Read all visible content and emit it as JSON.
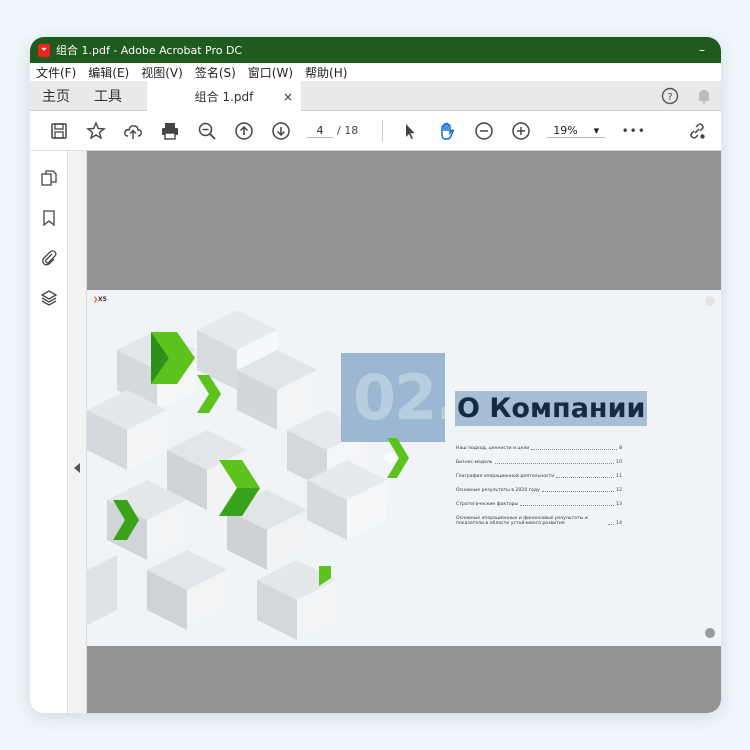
{
  "window": {
    "title": "组合 1.pdf - Adobe Acrobat Pro DC",
    "minimize_glyph": "–"
  },
  "menu": [
    "文件(F)",
    "编辑(E)",
    "视图(V)",
    "签名(S)",
    "窗口(W)",
    "帮助(H)"
  ],
  "tabs": {
    "home": "主页",
    "tools": "工具",
    "document": "组合 1.pdf",
    "close_glyph": "×"
  },
  "toolbar": {
    "page_current": "4",
    "page_total": "/ 18",
    "zoom": "19%",
    "zoom_caret": "▾",
    "more": "•••"
  },
  "document": {
    "brand": "X5",
    "chapter_number": "02.",
    "heading": "О Компании",
    "toc": [
      {
        "title": "Наш подход, ценности и цели",
        "page": "8"
      },
      {
        "title": "Бизнес-модель",
        "page": "10"
      },
      {
        "title": "География операционной деятельности",
        "page": "11"
      },
      {
        "title": "Основные результаты в 2020 году",
        "page": "12"
      },
      {
        "title": "Стратегические факторы",
        "page": "13"
      },
      {
        "title": "Основные операционные и финансовые результаты и показатели в области устойчивого развития",
        "page": "14"
      }
    ]
  },
  "colors": {
    "titlebar": "#1f5a1f",
    "accent_blue": "#0066cc",
    "viewport_bg": "#939393",
    "chapter_box": "#9cb7d1",
    "heading_text": "#142a45",
    "green": "#5cc21c"
  },
  "icons": {
    "toolbar": [
      "save-icon",
      "star-icon",
      "cloud-upload-icon",
      "print-icon",
      "zoom-out-search-icon",
      "prev-page-icon",
      "next-page-icon",
      "select-cursor-icon",
      "hand-tool-icon",
      "zoom-minus-icon",
      "zoom-plus-icon",
      "share-link-icon"
    ],
    "rail": [
      "pages-icon",
      "bookmark-icon",
      "attachment-icon",
      "layers-icon"
    ]
  }
}
